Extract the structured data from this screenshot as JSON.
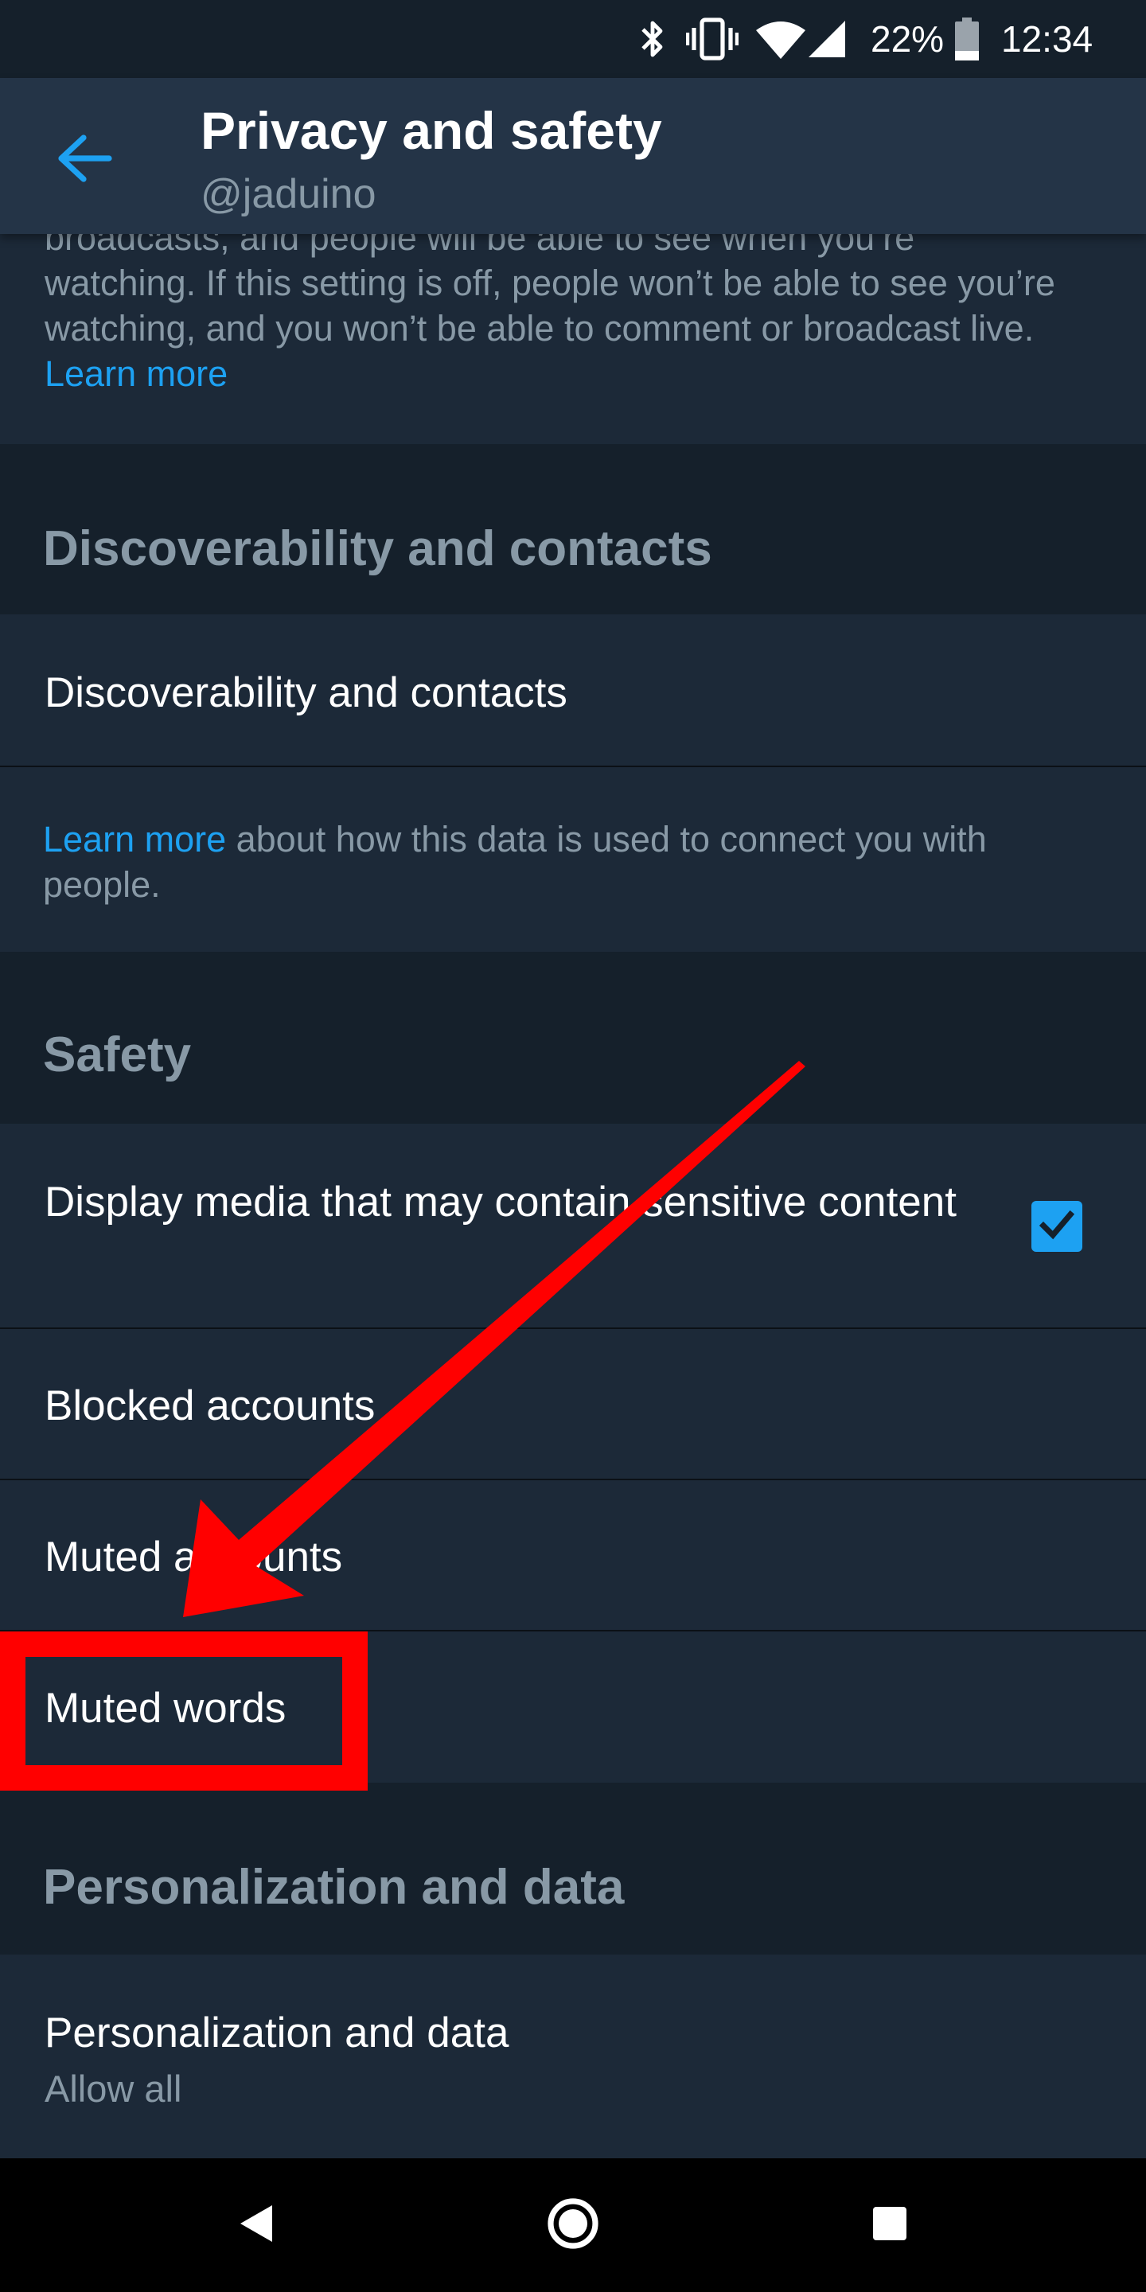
{
  "status_bar": {
    "battery_percent": "22%",
    "time": "12:34",
    "icons": [
      "bluetooth-icon",
      "vibrate-icon",
      "wifi-icon",
      "signal-icon",
      "battery-icon"
    ]
  },
  "app_bar": {
    "title": "Privacy and safety",
    "subtitle": "@jaduino",
    "back_icon": "arrow-left-icon"
  },
  "periscope": {
    "desc_line1": "broadcasts, and people will be able to see when you’re",
    "desc_rest": "watching. If this setting is off, people won’t be able to see you’re watching, and you won’t be able to comment or broadcast live. ",
    "learn_more": "Learn more"
  },
  "discoverability": {
    "section_title": "Discoverability and contacts",
    "row_label": "Discoverability and contacts",
    "learn_more": "Learn more",
    "desc": " about how this data is used to connect you with people."
  },
  "safety": {
    "section_title": "Safety",
    "sensitive_media_label": "Display media that may contain sensitive content",
    "sensitive_media_checked": true,
    "blocked_accounts": "Blocked accounts",
    "muted_accounts": "Muted accounts",
    "muted_words": "Muted words"
  },
  "personalization": {
    "section_title": "Personalization and data",
    "row_label": "Personalization and data",
    "row_value": "Allow all"
  },
  "annotation": {
    "highlight_color": "#ff0000",
    "arrow_color": "#ff0000"
  },
  "nav_bar": {
    "back_icon": "triangle-back-icon",
    "home_icon": "circle-home-icon",
    "recents_icon": "square-recents-icon"
  },
  "colors": {
    "accent": "#1da1f2",
    "background": "#15202b",
    "panel": "#1c2938",
    "app_bar": "#243447",
    "secondary_text": "#8899a6"
  }
}
